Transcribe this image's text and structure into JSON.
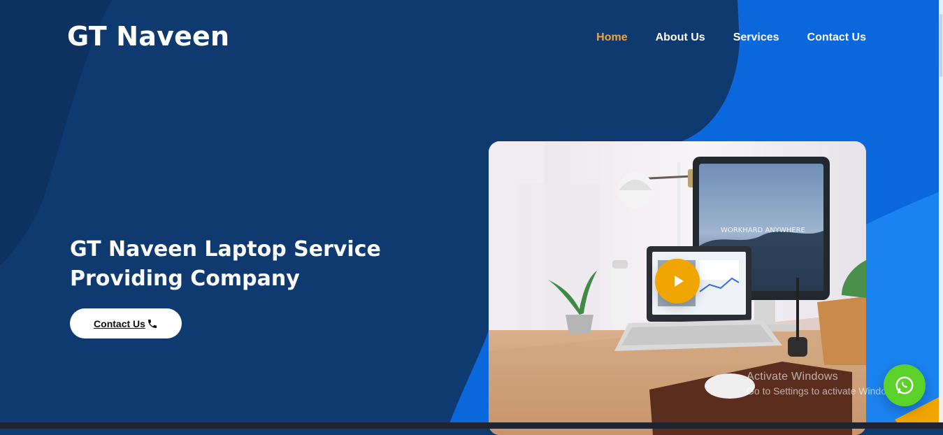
{
  "header": {
    "logo_text": "GT Naveen",
    "nav": [
      {
        "label": "Home",
        "active": true
      },
      {
        "label": "About Us",
        "active": false
      },
      {
        "label": "Services",
        "active": false
      },
      {
        "label": "Contact Us",
        "active": false
      }
    ]
  },
  "hero": {
    "title_line1": "GT Naveen Laptop Service",
    "title_line2": "Providing Company",
    "cta_label": "Contact Us",
    "cta_icon": "phone-icon"
  },
  "media": {
    "play_icon": "play-icon",
    "image_caption": "WORKHARD ANYWHERE"
  },
  "system_overlay": {
    "line1": "Activate Windows",
    "line2": "Go to Settings to activate Windows."
  },
  "floating": {
    "whatsapp_icon": "whatsapp-icon"
  },
  "colors": {
    "bg_dark": "#0f3a70",
    "bg_bright": "#0a6ee6",
    "accent_orange": "#f2a53a",
    "play_yellow": "#f0a500",
    "whatsapp_green": "#5bd22a"
  }
}
